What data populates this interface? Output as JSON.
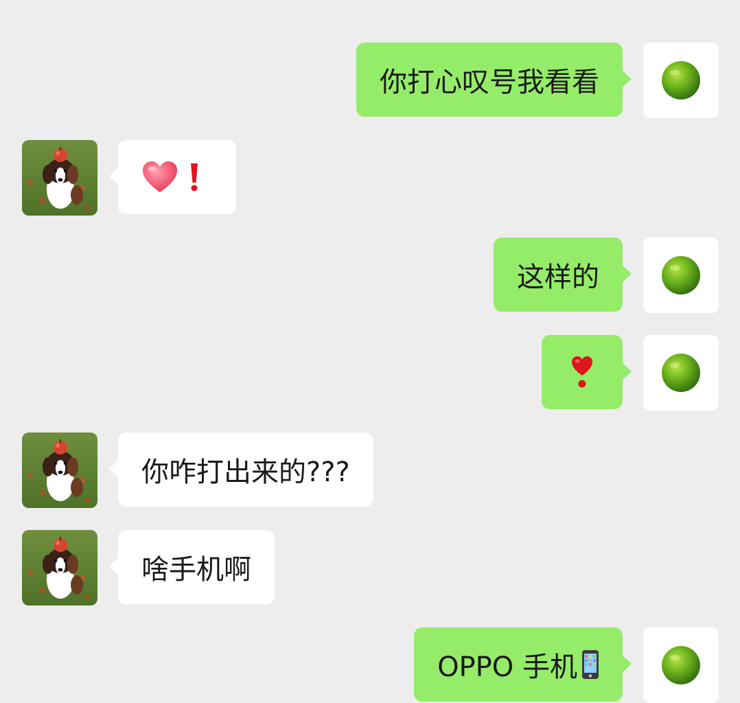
{
  "messages": [
    {
      "side": "right",
      "text": "你打心叹号我看看"
    },
    {
      "side": "left",
      "text": "",
      "emoji": [
        "heart-emoji",
        "red-exclamation-emoji"
      ]
    },
    {
      "side": "right",
      "text": "这样的"
    },
    {
      "side": "right",
      "text": "",
      "emoji": [
        "heavy-heart-exclamation-emoji"
      ]
    },
    {
      "side": "left",
      "text": "你咋打出来的???"
    },
    {
      "side": "left",
      "text": "啥手机啊"
    },
    {
      "side": "right",
      "text": "OPPO 手机",
      "emoji": [
        "mobile-phone-emoji"
      ]
    }
  ],
  "colors": {
    "background": "#ededed",
    "outgoing_bubble": "#95ec69",
    "incoming_bubble": "#ffffff",
    "text": "#1a1a1a"
  },
  "avatars": {
    "self": "green-lime-avatar",
    "other": "dog-with-apple-avatar"
  }
}
